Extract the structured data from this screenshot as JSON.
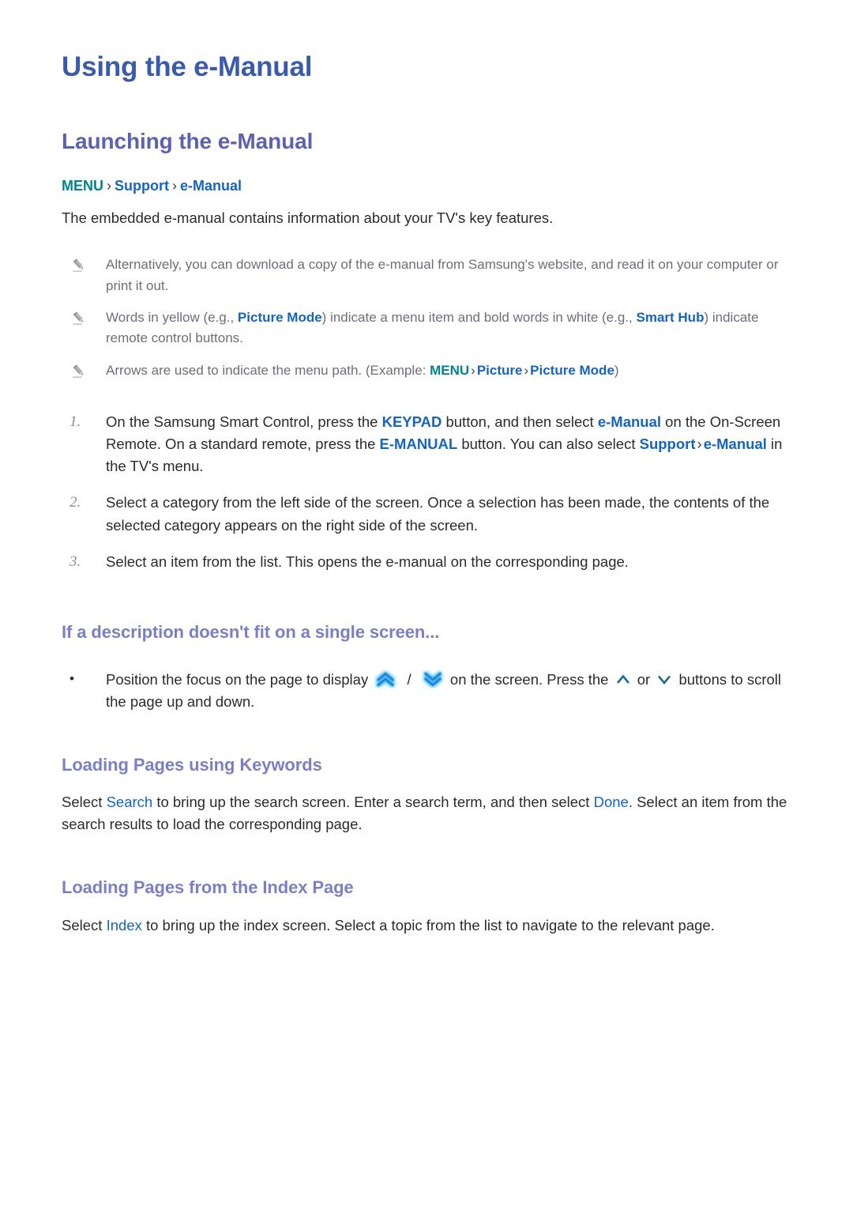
{
  "document": {
    "title": "Using the e-Manual"
  },
  "section_launching": {
    "heading": "Launching the e-Manual",
    "breadcrumb": {
      "menu": "MENU",
      "separator": "›",
      "support": "Support",
      "emanual": "e-Manual"
    },
    "intro": "The embedded e-manual contains information about your TV's key features.",
    "notes": [
      {
        "icon": "pencil-icon",
        "parts": [
          {
            "type": "text",
            "value": "Alternatively, you can download a copy of the e-manual from Samsung's website, and read it on your computer or print it out."
          }
        ]
      },
      {
        "icon": "pencil-icon",
        "parts": [
          {
            "type": "text",
            "value": "Words in yellow (e.g., "
          },
          {
            "type": "item",
            "value": "Picture Mode"
          },
          {
            "type": "text",
            "value": ") indicate a menu item and bold words in white (e.g., "
          },
          {
            "type": "item",
            "value": "Smart Hub"
          },
          {
            "type": "text",
            "value": ") indicate remote control buttons."
          }
        ]
      },
      {
        "icon": "pencil-icon",
        "parts": [
          {
            "type": "text",
            "value": "Arrows are used to indicate the menu path. (Example: "
          },
          {
            "type": "menu",
            "value": "MENU"
          },
          {
            "type": "sep",
            "value": "›"
          },
          {
            "type": "item",
            "value": "Picture"
          },
          {
            "type": "sep",
            "value": "›"
          },
          {
            "type": "item",
            "value": "Picture Mode"
          },
          {
            "type": "text",
            "value": ")"
          }
        ]
      }
    ],
    "steps": [
      {
        "number": "1.",
        "parts": [
          {
            "type": "text",
            "value": "On the Samsung Smart Control, press the "
          },
          {
            "type": "item",
            "value": "KEYPAD"
          },
          {
            "type": "text",
            "value": " button, and then select "
          },
          {
            "type": "item",
            "value": "e-Manual"
          },
          {
            "type": "text",
            "value": " on the On-Screen Remote. On a standard remote, press the "
          },
          {
            "type": "item",
            "value": "E-MANUAL"
          },
          {
            "type": "text",
            "value": " button. You can also select "
          },
          {
            "type": "item",
            "value": "Support"
          },
          {
            "type": "sep",
            "value": "›"
          },
          {
            "type": "item",
            "value": "e-Manual"
          },
          {
            "type": "text",
            "value": " in the TV's menu."
          }
        ]
      },
      {
        "number": "2.",
        "parts": [
          {
            "type": "text",
            "value": "Select a category from the left side of the screen. Once a selection has been made, the contents of the selected category appears on the right side of the screen."
          }
        ]
      },
      {
        "number": "3.",
        "parts": [
          {
            "type": "text",
            "value": "Select an item from the list. This opens the e-manual on the corresponding page."
          }
        ]
      }
    ]
  },
  "section_scroll": {
    "heading": "If a description doesn't fit on a single screen...",
    "bullet": {
      "marker": "•",
      "text_before": "Position the focus on the page to display",
      "icon_up_glow": "chevron-up-glow-icon",
      "slash": "/",
      "icon_down_glow": "chevron-down-glow-icon",
      "text_middle": "on the screen. Press the",
      "icon_up": "chevron-up-icon",
      "text_or": "or",
      "icon_down": "chevron-down-icon",
      "text_after": "buttons to scroll the page up and down."
    }
  },
  "section_keywords": {
    "heading": "Loading Pages using Keywords",
    "parts": [
      {
        "type": "text",
        "value": "Select "
      },
      {
        "type": "link",
        "value": "Search"
      },
      {
        "type": "text",
        "value": " to bring up the search screen. Enter a search term, and then select "
      },
      {
        "type": "link",
        "value": "Done"
      },
      {
        "type": "text",
        "value": ". Select an item from the search results to load the corresponding page."
      }
    ]
  },
  "section_index": {
    "heading": "Loading Pages from the Index Page",
    "parts": [
      {
        "type": "text",
        "value": "Select "
      },
      {
        "type": "link",
        "value": "Index"
      },
      {
        "type": "text",
        "value": " to bring up the index screen. Select a topic from the list to navigate to the relevant page."
      }
    ]
  },
  "colors": {
    "title": "#3a5ba9",
    "h2": "#5b63b0",
    "h3": "#7b7fc4",
    "menu_teal": "#00838f",
    "item_blue": "#1565c0",
    "body": "#2b2b2b",
    "note": "#6e6e78",
    "chevron_glow": "#35b6f2",
    "chevron_plain": "#1a6e8e"
  }
}
